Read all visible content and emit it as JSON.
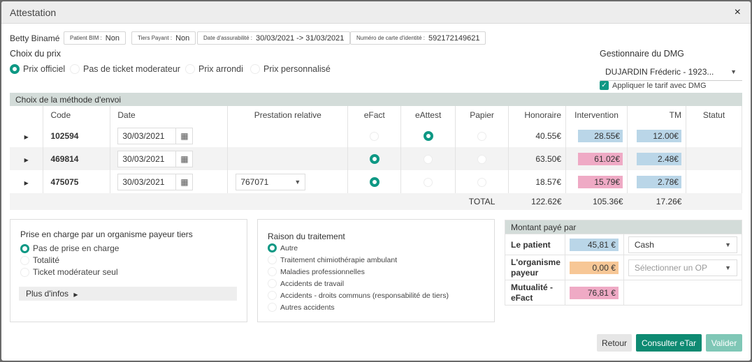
{
  "window": {
    "title": "Attestation",
    "close": "×"
  },
  "patient": {
    "name": "Betty Binamé",
    "pills": [
      {
        "key": "Patient BIM :",
        "value": "Non"
      },
      {
        "key": "Tiers Payant :",
        "value": "Non"
      },
      {
        "key": "Date d'assurabilité :",
        "value": "30/03/2021 -> 31/03/2021"
      },
      {
        "key": "Numéro de carte d'identité :",
        "value": "592172149621"
      }
    ]
  },
  "price": {
    "label": "Choix du prix",
    "options": [
      "Prix officiel",
      "Pas de ticket moderateur",
      "Prix arrondi",
      "Prix personnalisé"
    ],
    "selected": "Prix officiel"
  },
  "dmg": {
    "label": "Gestionnaire du DMG",
    "value": "DUJARDIN Fréderic - 1923...",
    "checkbox_label": "Appliquer le tarif avec DMG",
    "checked": true
  },
  "send_method": {
    "label": "Choix de la méthode d'envoi",
    "columns": [
      "Code",
      "Date",
      "Prestation relative",
      "eFact",
      "eAttest",
      "Papier",
      "Honoraire",
      "Intervention",
      "TM",
      "Statut"
    ],
    "rows": [
      {
        "code": "102594",
        "date": "30/03/2021",
        "relative": "",
        "method": "eAttest",
        "honoraire": "40.55€",
        "intervention": "28.55€",
        "tm": "12.00€",
        "intervention_color": "blue"
      },
      {
        "code": "469814",
        "date": "30/03/2021",
        "relative": "",
        "method": "eFact",
        "honoraire": "63.50€",
        "intervention": "61.02€",
        "tm": "2.48€",
        "intervention_color": "pink"
      },
      {
        "code": "475075",
        "date": "30/03/2021",
        "relative": "767071",
        "method": "eFact",
        "honoraire": "18.57€",
        "intervention": "15.79€",
        "tm": "2.78€",
        "intervention_color": "pink"
      }
    ],
    "total": {
      "label": "TOTAL",
      "honoraire": "122.62€",
      "intervention": "105.36€",
      "tm": "17.26€"
    }
  },
  "third_party": {
    "title": "Prise en charge par un organisme payeur tiers",
    "options": [
      "Pas de prise en charge",
      "Totalité",
      "Ticket modérateur seul"
    ],
    "selected": "Pas de prise en charge",
    "more_info": "Plus d'infos"
  },
  "reason": {
    "title": "Raison du traitement",
    "options": [
      "Autre",
      "Traitement chimiothérapie ambulant",
      "Maladies professionnelles",
      "Accidents de travail",
      "Accidents - droits communs (responsabilité de tiers)",
      "Autres accidents"
    ],
    "selected": "Autre"
  },
  "paid_by": {
    "title": "Montant payé par",
    "rows": [
      {
        "label": "Le patient",
        "amount": "45,81 €",
        "select_value": "Cash",
        "select_placeholder": ""
      },
      {
        "label": "L'organisme payeur",
        "amount": "0,00 €",
        "select_value": "",
        "select_placeholder": "Sélectionner un OP"
      },
      {
        "label": "Mutualité - eFact",
        "amount": "76,81 €",
        "select_value": "",
        "select_placeholder": ""
      }
    ]
  },
  "buttons": {
    "back": "Retour",
    "consult": "Consulter eTar",
    "validate": "Valider"
  },
  "colors": {
    "accent": "#0e9884",
    "blue_tag": "#bad6e8",
    "pink_tag": "#efaac5",
    "orange_tag": "#f7c796",
    "section_bar": "#d3dcd9"
  }
}
